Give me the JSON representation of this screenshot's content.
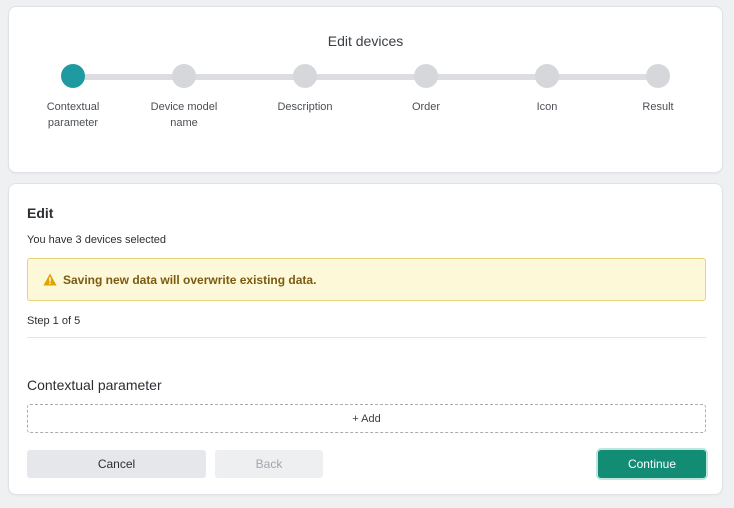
{
  "stepper": {
    "title": "Edit devices",
    "steps": [
      {
        "label": "Contextual parameter",
        "active": true
      },
      {
        "label": "Device model name",
        "active": false
      },
      {
        "label": "Description",
        "active": false
      },
      {
        "label": "Order",
        "active": false
      },
      {
        "label": "Icon",
        "active": false
      },
      {
        "label": "Result",
        "active": false
      }
    ]
  },
  "edit": {
    "heading": "Edit",
    "selected_text": "You have 3 devices selected",
    "warning_text": "Saving new data will overwrite existing data.",
    "step_count": "Step 1 of 5",
    "section_title": "Contextual parameter",
    "add_label": "+ Add"
  },
  "buttons": {
    "cancel": "Cancel",
    "back": "Back",
    "continue": "Continue"
  },
  "colors": {
    "active_step": "#1f9aa0",
    "inactive_step": "#d6d7da",
    "continue_button": "#138c75",
    "warning_background": "#fcf8d8",
    "warning_icon": "#e0a300"
  }
}
